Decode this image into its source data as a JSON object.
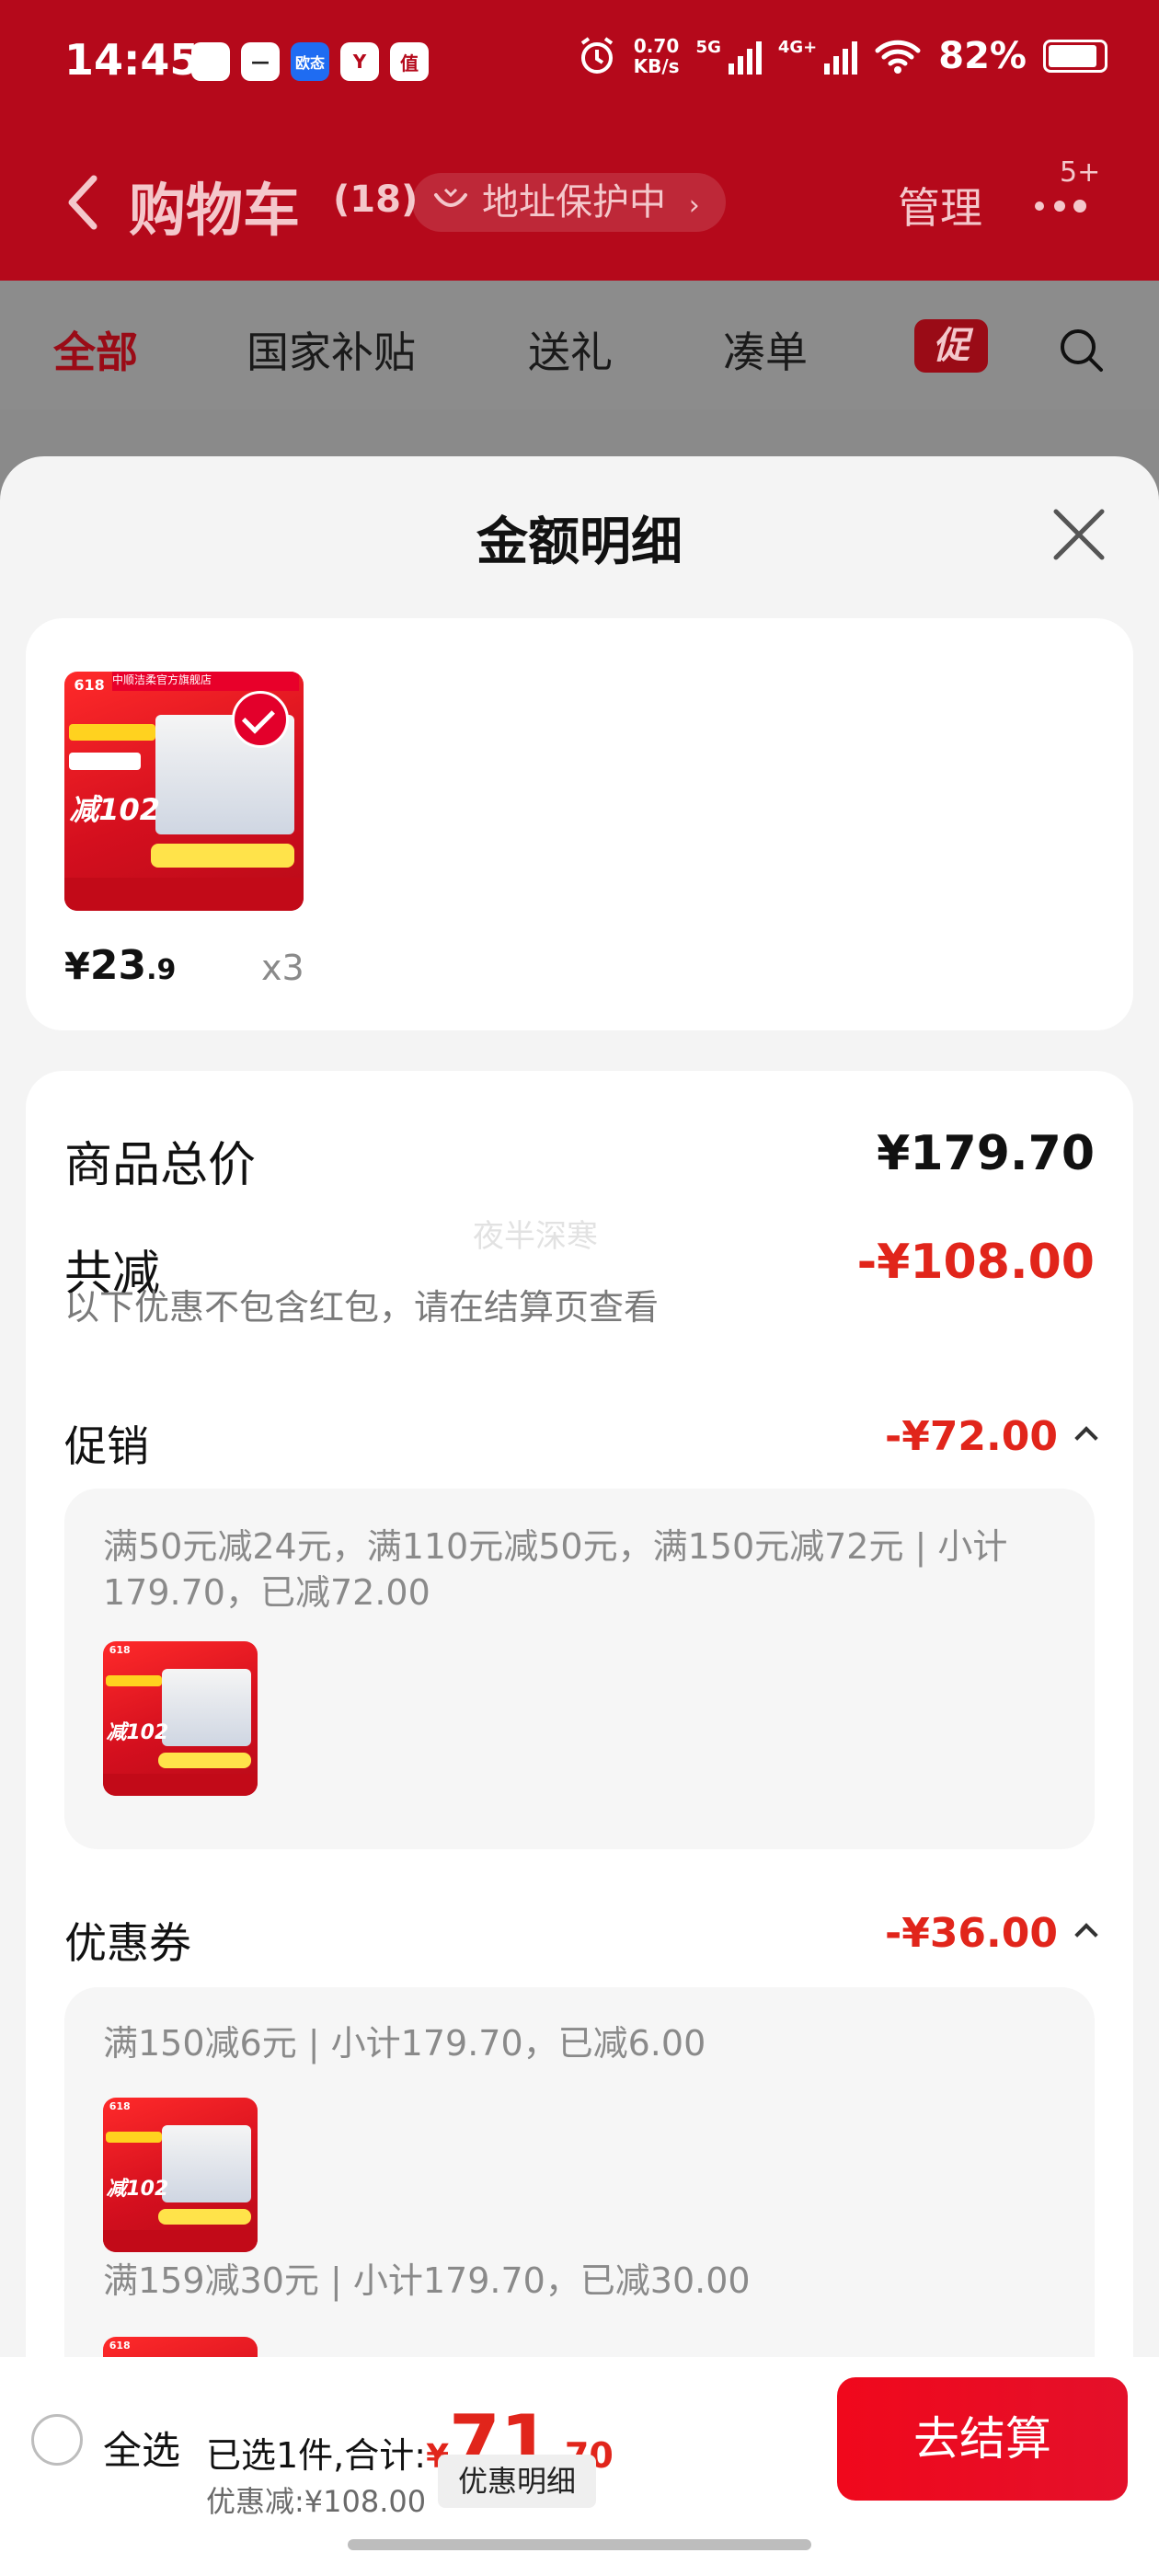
{
  "status_bar": {
    "time": "14:45",
    "net_speed_value": "0.70",
    "net_speed_unit": "KB/s",
    "sig1": "5G",
    "sig2": "4G+",
    "battery": "82%",
    "app_icons": [
      "home-app-icon",
      "dash-app-icon",
      "blue-app-icon",
      "y-app-icon",
      "zhi-app-icon"
    ],
    "app_icon_texts": [
      "",
      "—",
      "欧态",
      "Y",
      "值"
    ]
  },
  "nav": {
    "title": "购物车",
    "count": "(18)",
    "address_protection": "地址保护中",
    "manage": "管理",
    "more_badge": "5+"
  },
  "tabs": [
    "全部",
    "国家补贴",
    "送礼",
    "凑单"
  ],
  "promo_tab": "促",
  "sheet": {
    "title": "金额明细",
    "item": {
      "price_symbol": "¥",
      "price_int": "23",
      "price_dec": ".9",
      "qty": "x3"
    },
    "summary": {
      "total_label": "商品总价",
      "total_value": "¥179.70",
      "reduced_label": "共减",
      "reduced_value": "-¥108.00",
      "note": "以下优惠不包含红包，请在结算页查看",
      "watermark": "夜半深寒",
      "promo_label": "促销",
      "promo_value": "-¥72.00",
      "promo_detail": "满50元减24元，满110元减50元，满150元减72元 | 小计179.70，已减72.00",
      "coupon_label": "优惠券",
      "coupon_value": "-¥36.00",
      "coupon_detail_1": "满150减6元 | 小计179.70，已减6.00",
      "coupon_detail_2": "满159减30元 | 小计179.70，已减30.00"
    },
    "product_image": {
      "badge": "618",
      "store": "中顺洁柔官方旗舰店",
      "headline": "减102"
    }
  },
  "bottom": {
    "select_all": "全选",
    "selected_prefix": "已选1件,合计:",
    "total_symbol": "¥",
    "total_int": "71",
    "total_dec": ".70",
    "discount_text": "优惠减:¥108.00",
    "discount_button": "优惠明细",
    "checkout": "去结算"
  },
  "colors": {
    "header_red": "#b5091b",
    "accent_red": "#e1251b",
    "checkout_red": "#f0081c"
  }
}
